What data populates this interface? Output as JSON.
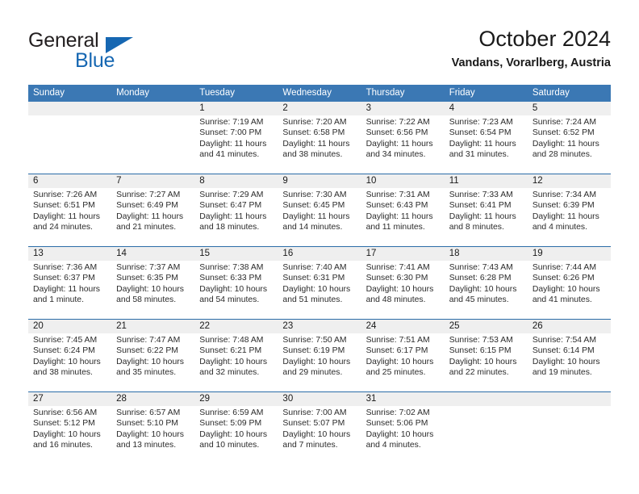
{
  "brand": {
    "name_top": "General",
    "name_bottom": "Blue",
    "triangle_color": "#1667b2",
    "text_color": "#231f20"
  },
  "header": {
    "title": "October 2024",
    "subtitle": "Vandans, Vorarlberg, Austria"
  },
  "theme": {
    "header_blue": "#3b78b4",
    "row_line_blue": "#2b6ca8",
    "daynum_band_gray": "#efefef",
    "text_color": "#1a1a1a"
  },
  "calendar": {
    "weekdays": [
      "Sunday",
      "Monday",
      "Tuesday",
      "Wednesday",
      "Thursday",
      "Friday",
      "Saturday"
    ],
    "labels": {
      "sunrise": "Sunrise:",
      "sunset": "Sunset:",
      "daylight": "Daylight:"
    },
    "weeks": [
      [
        {
          "day": ""
        },
        {
          "day": ""
        },
        {
          "day": "1",
          "sunrise": "Sunrise: 7:19 AM",
          "sunset": "Sunset: 7:00 PM",
          "daylight": "Daylight: 11 hours and 41 minutes."
        },
        {
          "day": "2",
          "sunrise": "Sunrise: 7:20 AM",
          "sunset": "Sunset: 6:58 PM",
          "daylight": "Daylight: 11 hours and 38 minutes."
        },
        {
          "day": "3",
          "sunrise": "Sunrise: 7:22 AM",
          "sunset": "Sunset: 6:56 PM",
          "daylight": "Daylight: 11 hours and 34 minutes."
        },
        {
          "day": "4",
          "sunrise": "Sunrise: 7:23 AM",
          "sunset": "Sunset: 6:54 PM",
          "daylight": "Daylight: 11 hours and 31 minutes."
        },
        {
          "day": "5",
          "sunrise": "Sunrise: 7:24 AM",
          "sunset": "Sunset: 6:52 PM",
          "daylight": "Daylight: 11 hours and 28 minutes."
        }
      ],
      [
        {
          "day": "6",
          "sunrise": "Sunrise: 7:26 AM",
          "sunset": "Sunset: 6:51 PM",
          "daylight": "Daylight: 11 hours and 24 minutes."
        },
        {
          "day": "7",
          "sunrise": "Sunrise: 7:27 AM",
          "sunset": "Sunset: 6:49 PM",
          "daylight": "Daylight: 11 hours and 21 minutes."
        },
        {
          "day": "8",
          "sunrise": "Sunrise: 7:29 AM",
          "sunset": "Sunset: 6:47 PM",
          "daylight": "Daylight: 11 hours and 18 minutes."
        },
        {
          "day": "9",
          "sunrise": "Sunrise: 7:30 AM",
          "sunset": "Sunset: 6:45 PM",
          "daylight": "Daylight: 11 hours and 14 minutes."
        },
        {
          "day": "10",
          "sunrise": "Sunrise: 7:31 AM",
          "sunset": "Sunset: 6:43 PM",
          "daylight": "Daylight: 11 hours and 11 minutes."
        },
        {
          "day": "11",
          "sunrise": "Sunrise: 7:33 AM",
          "sunset": "Sunset: 6:41 PM",
          "daylight": "Daylight: 11 hours and 8 minutes."
        },
        {
          "day": "12",
          "sunrise": "Sunrise: 7:34 AM",
          "sunset": "Sunset: 6:39 PM",
          "daylight": "Daylight: 11 hours and 4 minutes."
        }
      ],
      [
        {
          "day": "13",
          "sunrise": "Sunrise: 7:36 AM",
          "sunset": "Sunset: 6:37 PM",
          "daylight": "Daylight: 11 hours and 1 minute."
        },
        {
          "day": "14",
          "sunrise": "Sunrise: 7:37 AM",
          "sunset": "Sunset: 6:35 PM",
          "daylight": "Daylight: 10 hours and 58 minutes."
        },
        {
          "day": "15",
          "sunrise": "Sunrise: 7:38 AM",
          "sunset": "Sunset: 6:33 PM",
          "daylight": "Daylight: 10 hours and 54 minutes."
        },
        {
          "day": "16",
          "sunrise": "Sunrise: 7:40 AM",
          "sunset": "Sunset: 6:31 PM",
          "daylight": "Daylight: 10 hours and 51 minutes."
        },
        {
          "day": "17",
          "sunrise": "Sunrise: 7:41 AM",
          "sunset": "Sunset: 6:30 PM",
          "daylight": "Daylight: 10 hours and 48 minutes."
        },
        {
          "day": "18",
          "sunrise": "Sunrise: 7:43 AM",
          "sunset": "Sunset: 6:28 PM",
          "daylight": "Daylight: 10 hours and 45 minutes."
        },
        {
          "day": "19",
          "sunrise": "Sunrise: 7:44 AM",
          "sunset": "Sunset: 6:26 PM",
          "daylight": "Daylight: 10 hours and 41 minutes."
        }
      ],
      [
        {
          "day": "20",
          "sunrise": "Sunrise: 7:45 AM",
          "sunset": "Sunset: 6:24 PM",
          "daylight": "Daylight: 10 hours and 38 minutes."
        },
        {
          "day": "21",
          "sunrise": "Sunrise: 7:47 AM",
          "sunset": "Sunset: 6:22 PM",
          "daylight": "Daylight: 10 hours and 35 minutes."
        },
        {
          "day": "22",
          "sunrise": "Sunrise: 7:48 AM",
          "sunset": "Sunset: 6:21 PM",
          "daylight": "Daylight: 10 hours and 32 minutes."
        },
        {
          "day": "23",
          "sunrise": "Sunrise: 7:50 AM",
          "sunset": "Sunset: 6:19 PM",
          "daylight": "Daylight: 10 hours and 29 minutes."
        },
        {
          "day": "24",
          "sunrise": "Sunrise: 7:51 AM",
          "sunset": "Sunset: 6:17 PM",
          "daylight": "Daylight: 10 hours and 25 minutes."
        },
        {
          "day": "25",
          "sunrise": "Sunrise: 7:53 AM",
          "sunset": "Sunset: 6:15 PM",
          "daylight": "Daylight: 10 hours and 22 minutes."
        },
        {
          "day": "26",
          "sunrise": "Sunrise: 7:54 AM",
          "sunset": "Sunset: 6:14 PM",
          "daylight": "Daylight: 10 hours and 19 minutes."
        }
      ],
      [
        {
          "day": "27",
          "sunrise": "Sunrise: 6:56 AM",
          "sunset": "Sunset: 5:12 PM",
          "daylight": "Daylight: 10 hours and 16 minutes."
        },
        {
          "day": "28",
          "sunrise": "Sunrise: 6:57 AM",
          "sunset": "Sunset: 5:10 PM",
          "daylight": "Daylight: 10 hours and 13 minutes."
        },
        {
          "day": "29",
          "sunrise": "Sunrise: 6:59 AM",
          "sunset": "Sunset: 5:09 PM",
          "daylight": "Daylight: 10 hours and 10 minutes."
        },
        {
          "day": "30",
          "sunrise": "Sunrise: 7:00 AM",
          "sunset": "Sunset: 5:07 PM",
          "daylight": "Daylight: 10 hours and 7 minutes."
        },
        {
          "day": "31",
          "sunrise": "Sunrise: 7:02 AM",
          "sunset": "Sunset: 5:06 PM",
          "daylight": "Daylight: 10 hours and 4 minutes."
        },
        {
          "day": ""
        },
        {
          "day": ""
        }
      ]
    ]
  }
}
